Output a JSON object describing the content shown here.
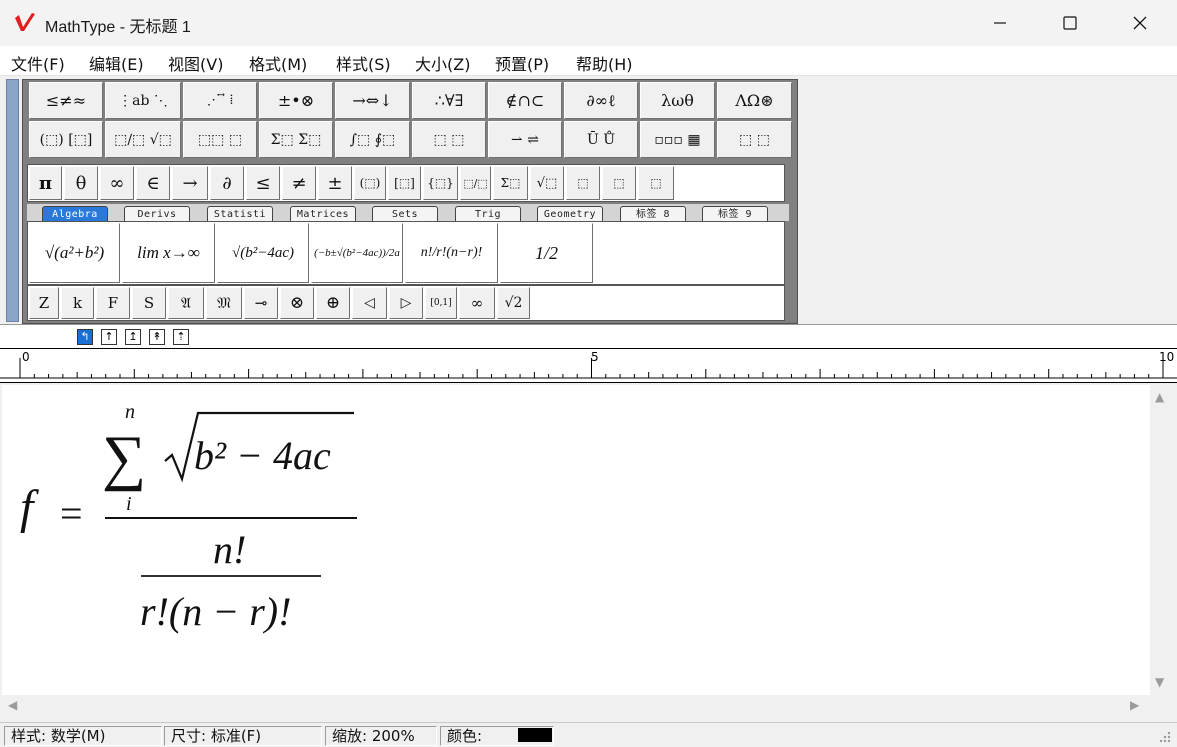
{
  "window": {
    "title": "MathType - 无标题 1"
  },
  "menu": [
    "文件(F)",
    "编辑(E)",
    "视图(V)",
    "格式(M)",
    "样式(S)",
    "大小(Z)",
    "预置(P)",
    "帮助(H)"
  ],
  "palette_row1": [
    "≤≠≈",
    "⋮ab ⋱",
    "⋰ ⃗ ⁞",
    "±•⊗",
    "→⇔↓",
    "∴∀∃",
    "∉∩⊂",
    "∂∞ℓ",
    "λωθ",
    "ΛΩ⊛"
  ],
  "palette_row2": [
    "(⬚) [⬚]",
    "⬚∕⬚ √⬚",
    "⬚⬚ ⬚",
    "Σ⬚ Σ⬚",
    "∫⬚ ∮⬚",
    "⬚ ⬚",
    "⇀ ⇌",
    "Ū Ů",
    "▫▫▫ ▦",
    "⬚ ⬚"
  ],
  "symbol_bar": [
    "π",
    "θ",
    "∞",
    "∈",
    "→",
    "∂",
    "≤",
    "≠",
    "±",
    "(⬚)",
    "[⬚]",
    "{⬚}",
    "⬚∕⬚",
    "Σ⬚",
    "√⬚",
    "⬚",
    "⬚",
    "⬚"
  ],
  "tabs": [
    "Algebra",
    "Derivs",
    "Statisti",
    "Matrices",
    "Sets",
    "Trig",
    "Geometry",
    "标签 8",
    "标签 9"
  ],
  "templates": [
    "√(a²+b²)",
    "lim x→∞",
    "√(b²−4ac)",
    "(−b±√(b²−4ac))/2a",
    "n!/r!(n−r)!",
    "1/2"
  ],
  "symbol_bar2": [
    "Z",
    "k",
    "F",
    "S",
    "𝔄",
    "𝔐",
    "⊸",
    "⊗",
    "⊕",
    "◁",
    "▷",
    "[0,1]",
    "∞",
    "√2"
  ],
  "ruler": {
    "marks": [
      "0",
      "5",
      "10"
    ]
  },
  "equation": {
    "lhs": "f",
    "equals": "=",
    "sum_upper": "n",
    "sum_lower": "i",
    "radicand": "b² − 4ac",
    "inner_num": "n!",
    "inner_den": "r!(n − r)!"
  },
  "status": {
    "style": "样式: 数学(M)",
    "size": "尺寸: 标准(F)",
    "zoom": "缩放: 200%",
    "color": "颜色:"
  },
  "colors": {
    "accent": "#2a78d8",
    "logo": "#e02020"
  }
}
